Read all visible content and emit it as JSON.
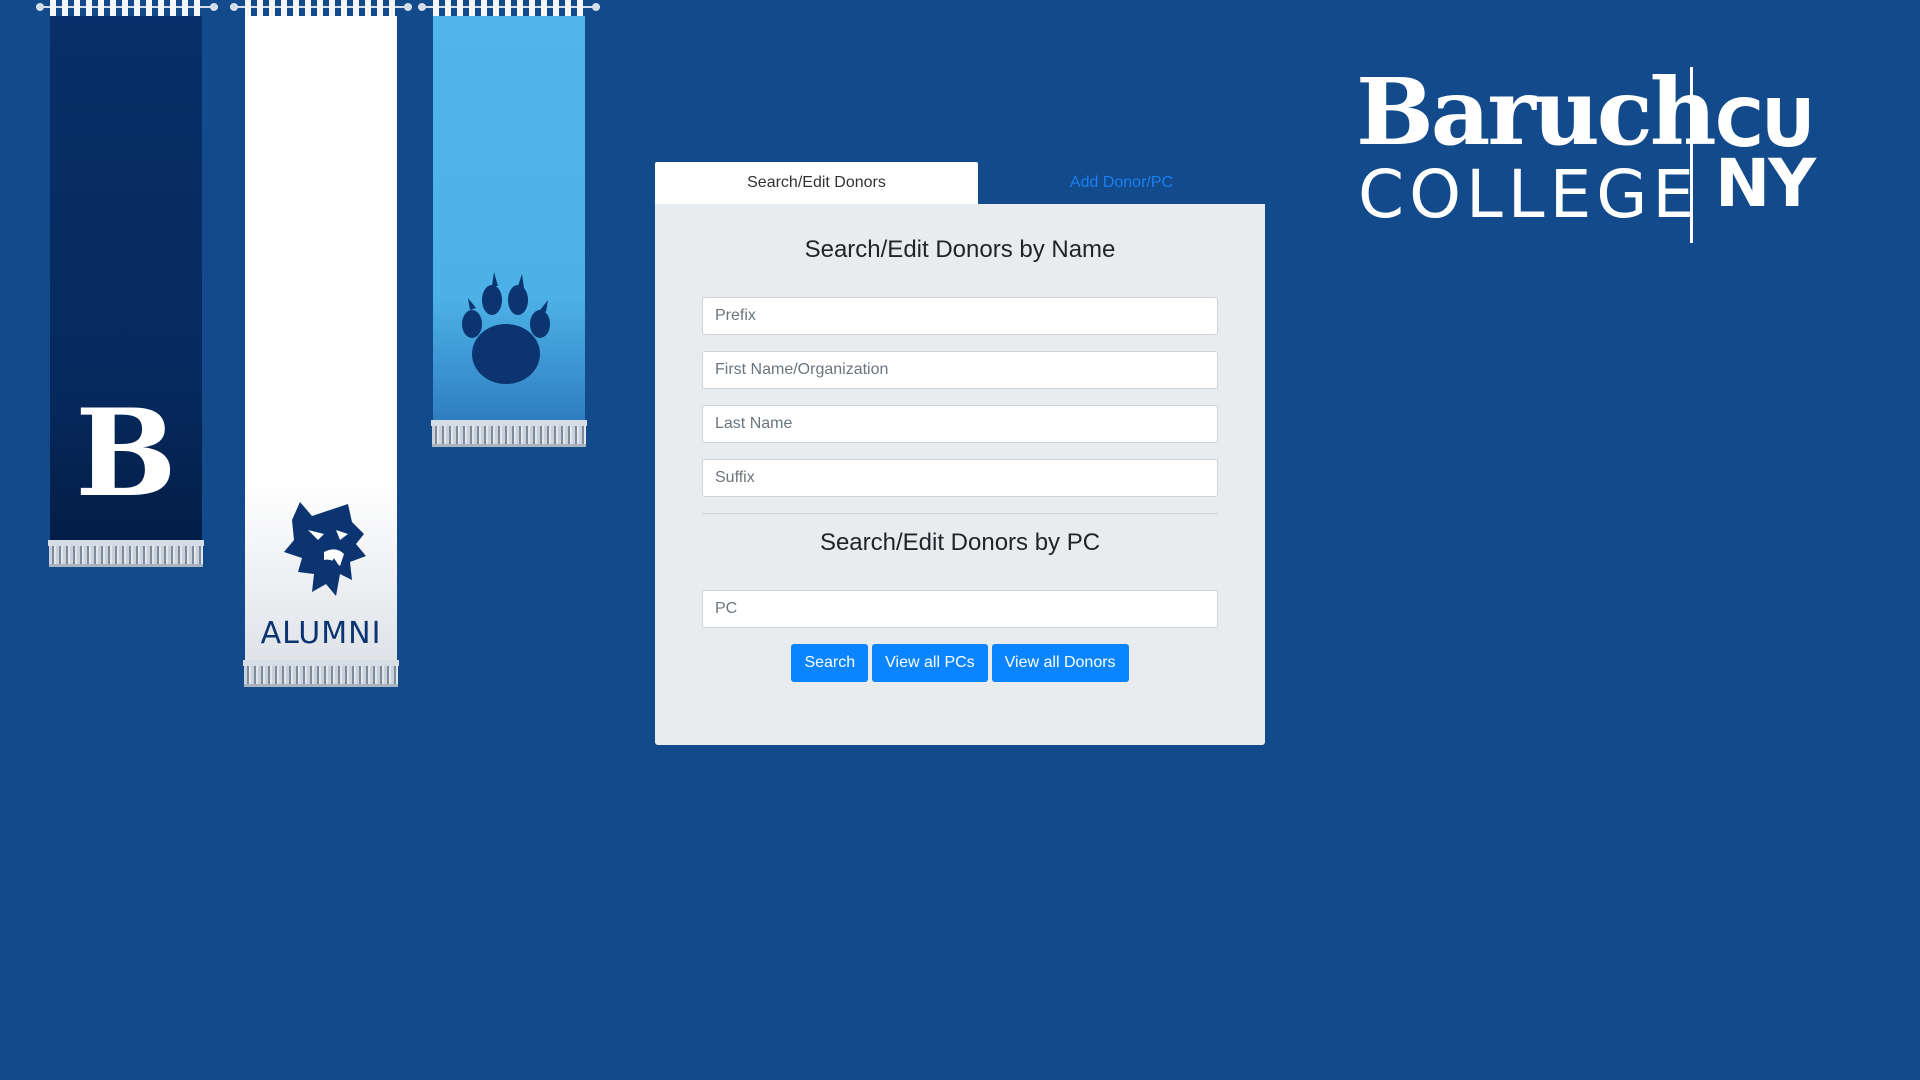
{
  "brand": {
    "baruch": "Baruch",
    "college": "COLLEGE",
    "cuny_line1": "CU",
    "cuny_line2": "NY"
  },
  "banners": {
    "left_letter": "B",
    "middle_label": "ALUMNI",
    "colors": {
      "dark": "#062e66",
      "white": "#ffffff",
      "light": "#4cb3e8",
      "background": "#124a8c"
    }
  },
  "tabs": [
    {
      "label": "Search/Edit Donors",
      "active": true
    },
    {
      "label": "Add Donor/PC",
      "active": false
    }
  ],
  "search_by_name": {
    "title": "Search/Edit Donors by Name",
    "fields": {
      "prefix_placeholder": "Prefix",
      "first_name_placeholder": "First Name/Organization",
      "last_name_placeholder": "Last Name",
      "suffix_placeholder": "Suffix"
    }
  },
  "search_by_pc": {
    "title": "Search/Edit Donors by PC",
    "pc_placeholder": "PC"
  },
  "buttons": {
    "search": "Search",
    "view_pcs": "View all PCs",
    "view_donors": "View all Donors"
  },
  "accent_color": "#0a84ff"
}
